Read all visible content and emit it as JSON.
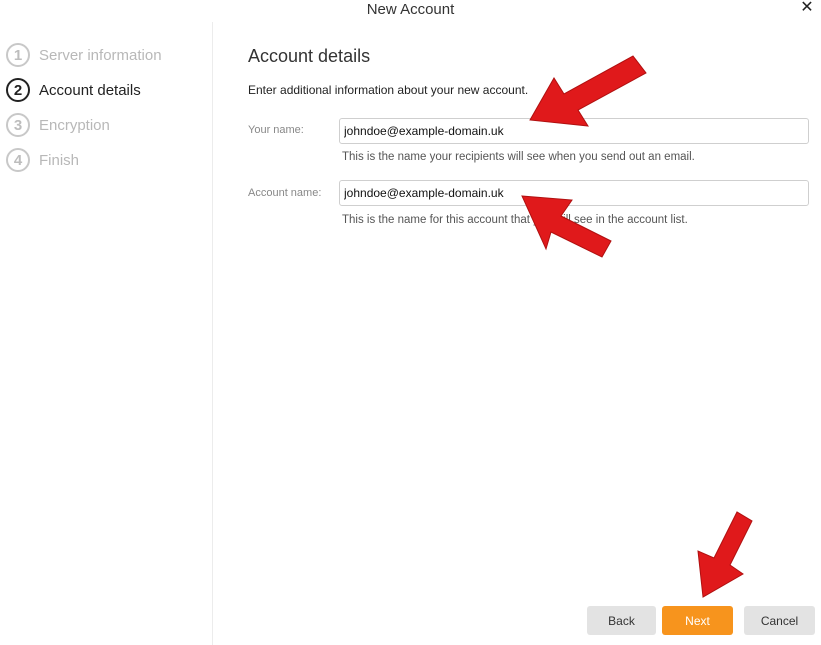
{
  "window": {
    "title": "New Account",
    "close_glyph": "✕"
  },
  "steps": [
    {
      "number": "1",
      "label": "Server information",
      "state": "inactive"
    },
    {
      "number": "2",
      "label": "Account details",
      "state": "active"
    },
    {
      "number": "3",
      "label": "Encryption",
      "state": "inactive"
    },
    {
      "number": "4",
      "label": "Finish",
      "state": "inactive"
    }
  ],
  "main": {
    "heading": "Account details",
    "intro": "Enter additional information about your new account.",
    "fields": [
      {
        "label": "Your name:",
        "value": "johndoe@example-domain.uk",
        "hint": "This is the name your recipients will see when you send out an email."
      },
      {
        "label": "Account name:",
        "value": "johndoe@example-domain.uk",
        "hint": "This is the name for this account that you will see in the account list."
      }
    ]
  },
  "buttons": {
    "back": "Back",
    "next": "Next",
    "cancel": "Cancel"
  },
  "colors": {
    "accent": "#f7941d",
    "annotation_arrow": "#e0191b"
  }
}
